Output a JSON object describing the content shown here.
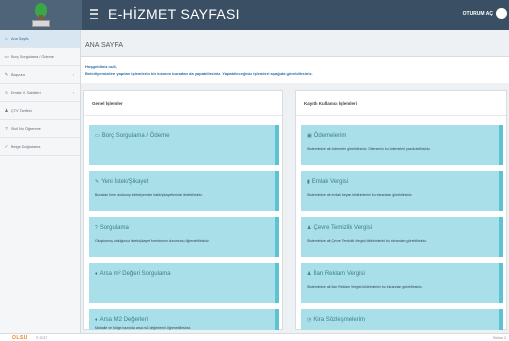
{
  "header": {
    "title": "E-HİZMET SAYFASI",
    "login": "OTURUM AÇ"
  },
  "sidebar": {
    "items": [
      {
        "label": "Ana Sayfa",
        "icon": "home-icon",
        "glyph": "⌂",
        "has_arrow": false
      },
      {
        "label": "Borç Sorgulama / Ödeme",
        "icon": "card-icon",
        "glyph": "▭",
        "has_arrow": false
      },
      {
        "label": "Başvuru",
        "icon": "pencil-icon",
        "glyph": "✎",
        "has_arrow": true,
        "arrow": "›"
      },
      {
        "label": "Emlak V. Sabitleri",
        "icon": "list-icon",
        "glyph": "≡",
        "has_arrow": true,
        "arrow": "›"
      },
      {
        "label": "ÇTV Tarifesi",
        "icon": "person-icon",
        "glyph": "♟",
        "has_arrow": false
      },
      {
        "label": "Sicil No Öğrenme",
        "icon": "help-icon",
        "glyph": "?",
        "has_arrow": false
      },
      {
        "label": "Belge Doğrulama",
        "icon": "check-icon",
        "glyph": "✓",
        "has_arrow": false
      }
    ]
  },
  "main": {
    "page_title": "ANA SAYFA",
    "welcome_line1": "Hoşgeldiniz null,",
    "welcome_line2": "Belediyemizden yapılan işlemlerin bir kısmını buradan da yapabilirsiniz. Yapabileceğiniz işlemleri aşağıda görebilirsiniz."
  },
  "general_panel": {
    "title": "Genel İşlemler",
    "cards": [
      {
        "icon": "card-icon",
        "glyph": "▭",
        "title": "Borç Sorgulama / Ödeme",
        "desc": ""
      },
      {
        "icon": "pencil-icon",
        "glyph": "✎",
        "title": "Yeni İstek/Şikayet",
        "desc": "Buradan form doldurup belediyemize istek/şikayetlerinizi iletebilirsiniz."
      },
      {
        "icon": "help-icon",
        "glyph": "?",
        "title": "Sorgulama",
        "desc": "Oluşturmuş olduğunuz istek/şikayet formlarının durumunu öğrenebilirsiniz."
      },
      {
        "icon": "drop-icon",
        "glyph": "♦",
        "title": "Arsa m² Değeri Sorgulama",
        "desc": ""
      },
      {
        "icon": "drop-icon",
        "glyph": "♦",
        "title": "Arsa M2 Değerleri",
        "desc": "Mahalle ve bölge bazında arsa m2 değerlerini öğrenebilirsiniz."
      }
    ]
  },
  "registered_panel": {
    "title": "Kayıtlı Kullanıcı İşlemleri",
    "cards": [
      {
        "icon": "money-icon",
        "glyph": "▣",
        "title": "Ödemelerim",
        "desc": "Sistemimize ait ödemeler görebilirsiniz. Dilerseniz bu ödemeleri yazdırabilirsiniz."
      },
      {
        "icon": "building-icon",
        "glyph": "▮",
        "title": "Emlak Vergisi",
        "desc": "Sistemimize ait emlak beyan bildirimlerini bu ekrandan görebilirsiniz."
      },
      {
        "icon": "person-icon",
        "glyph": "♟",
        "title": "Çevre Temizlik Vergisi",
        "desc": "Sistemimize ait Çevre Temizlik Vergisi bildirimlerini bu ekrandan görebilirsiniz."
      },
      {
        "icon": "person-icon",
        "glyph": "♟",
        "title": "İlan Reklam Vergisi",
        "desc": "Sistemimize ait İlan Reklam Vergisi bildirimlerini bu ekrandan görebilirsiniz."
      },
      {
        "icon": "clock-icon",
        "glyph": "◷",
        "title": "Kira Sözleşmelerim",
        "desc": ""
      }
    ]
  },
  "footer": {
    "brand": "OLSU",
    "copyright": "© 2017",
    "right": "Sürüm 2"
  },
  "colors": {
    "topbar": "#3a4f63",
    "card": "#a9dfe8",
    "card_border": "#5dc3d2",
    "accent": "#2a6fa8",
    "footer_brand": "#e8832a"
  }
}
